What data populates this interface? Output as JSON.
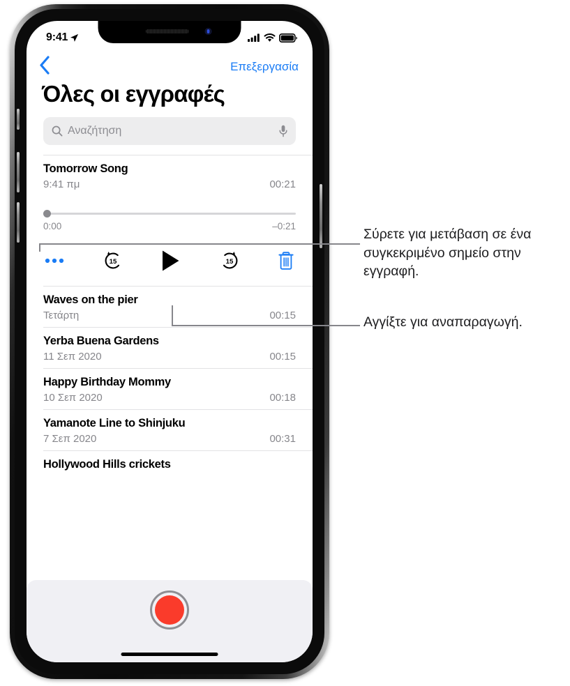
{
  "status_bar": {
    "time": "9:41",
    "location_icon": "location-arrow-icon",
    "cellular_icon": "cellular-signal-icon",
    "wifi_icon": "wifi-icon",
    "battery_icon": "battery-full-icon"
  },
  "nav": {
    "back_icon": "chevron-left-icon",
    "edit_label": "Επεξεργασία"
  },
  "page": {
    "title": "Όλες οι εγγραφές"
  },
  "search": {
    "placeholder": "Αναζήτηση",
    "search_icon": "search-icon",
    "mic_icon": "microphone-icon"
  },
  "player": {
    "title": "Tomorrow Song",
    "date": "9:41 πμ",
    "duration": "00:21",
    "elapsed": "0:00",
    "remaining": "–0:21",
    "progress_percent": 0,
    "controls": {
      "more_icon": "more-options-icon",
      "more_label": "•••",
      "skip_back_icon": "skip-back-15-icon",
      "skip_back_label": "15",
      "play_icon": "play-icon",
      "skip_forward_icon": "skip-forward-15-icon",
      "skip_forward_label": "15",
      "delete_icon": "trash-icon"
    }
  },
  "recordings": [
    {
      "title": "Waves on the pier",
      "date": "Τετάρτη",
      "duration": "00:15"
    },
    {
      "title": "Yerba Buena Gardens",
      "date": "11 Σεπ 2020",
      "duration": "00:15"
    },
    {
      "title": "Happy Birthday Mommy",
      "date": "10 Σεπ 2020",
      "duration": "00:18"
    },
    {
      "title": "Yamanote Line to Shinjuku",
      "date": "7 Σεπ 2020",
      "duration": "00:31"
    },
    {
      "title": "Hollywood Hills crickets",
      "date": "",
      "duration": ""
    }
  ],
  "record_bar": {
    "record_button_label": "record-button"
  },
  "callouts": [
    {
      "text": "Σύρετε για μετάβαση σε ένα συγκεκριμένο σημείο στην εγγραφή."
    },
    {
      "text": "Αγγίξτε για αναπαραγωγή."
    }
  ],
  "colors": {
    "accent_blue": "#1a7cf5",
    "record_red": "#fa3b2b",
    "secondary_text": "#86868b",
    "search_background": "#ededee",
    "bottom_bar": "#f0f0f4"
  }
}
